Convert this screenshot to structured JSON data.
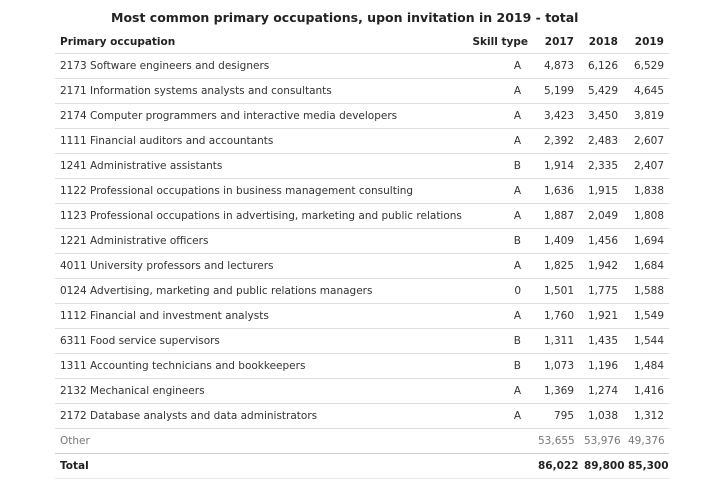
{
  "title": "Most common primary occupations, upon invitation in 2019 - total",
  "columns": {
    "occupation": "Primary occupation",
    "skill": "Skill type",
    "y2017": "2017",
    "y2018": "2018",
    "y2019": "2019"
  },
  "rows": [
    {
      "occupation": "2173 Software engineers and designers",
      "skill": "A",
      "y2017": "4,873",
      "y2018": "6,126",
      "y2019": "6,529"
    },
    {
      "occupation": "2171 Information systems analysts and consultants",
      "skill": "A",
      "y2017": "5,199",
      "y2018": "5,429",
      "y2019": "4,645"
    },
    {
      "occupation": "2174 Computer programmers and interactive media developers",
      "skill": "A",
      "y2017": "3,423",
      "y2018": "3,450",
      "y2019": "3,819"
    },
    {
      "occupation": "1111 Financial auditors and accountants",
      "skill": "A",
      "y2017": "2,392",
      "y2018": "2,483",
      "y2019": "2,607"
    },
    {
      "occupation": "1241 Administrative assistants",
      "skill": "B",
      "y2017": "1,914",
      "y2018": "2,335",
      "y2019": "2,407"
    },
    {
      "occupation": "1122 Professional occupations in business management consulting",
      "skill": "A",
      "y2017": "1,636",
      "y2018": "1,915",
      "y2019": "1,838"
    },
    {
      "occupation": "1123 Professional occupations in advertising, marketing and public relations",
      "skill": "A",
      "y2017": "1,887",
      "y2018": "2,049",
      "y2019": "1,808"
    },
    {
      "occupation": "1221 Administrative officers",
      "skill": "B",
      "y2017": "1,409",
      "y2018": "1,456",
      "y2019": "1,694"
    },
    {
      "occupation": "4011 University professors and lecturers",
      "skill": "A",
      "y2017": "1,825",
      "y2018": "1,942",
      "y2019": "1,684"
    },
    {
      "occupation": "0124 Advertising, marketing and public relations managers",
      "skill": "0",
      "y2017": "1,501",
      "y2018": "1,775",
      "y2019": "1,588"
    },
    {
      "occupation": "1112 Financial and investment analysts",
      "skill": "A",
      "y2017": "1,760",
      "y2018": "1,921",
      "y2019": "1,549"
    },
    {
      "occupation": "6311 Food service supervisors",
      "skill": "B",
      "y2017": "1,311",
      "y2018": "1,435",
      "y2019": "1,544"
    },
    {
      "occupation": "1311 Accounting technicians and bookkeepers",
      "skill": "B",
      "y2017": "1,073",
      "y2018": "1,196",
      "y2019": "1,484"
    },
    {
      "occupation": "2132 Mechanical engineers",
      "skill": "A",
      "y2017": "1,369",
      "y2018": "1,274",
      "y2019": "1,416"
    },
    {
      "occupation": "2172 Database analysts and data administrators",
      "skill": "A",
      "y2017": "795",
      "y2018": "1,038",
      "y2019": "1,312"
    }
  ],
  "other": {
    "label": "Other",
    "y2017": "53,655",
    "y2018": "53,976",
    "y2019": "49,376"
  },
  "total": {
    "label": "Total",
    "y2017": "86,022",
    "y2018": "89,800",
    "y2019": "85,300"
  }
}
